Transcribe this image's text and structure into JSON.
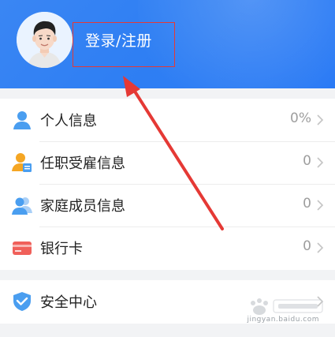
{
  "header": {
    "login_label": "登录/注册",
    "background_color": "#2f7ff3"
  },
  "menu": {
    "items": [
      {
        "label": "个人信息",
        "value": "0%",
        "icon": "person-icon"
      },
      {
        "label": "任职受雇信息",
        "value": "0",
        "icon": "employment-badge-icon"
      },
      {
        "label": "家庭成员信息",
        "value": "0",
        "icon": "family-members-icon"
      },
      {
        "label": "银行卡",
        "value": "0",
        "icon": "bank-card-icon"
      }
    ],
    "security": {
      "label": "安全中心",
      "icon": "shield-check-icon"
    }
  },
  "watermark": {
    "text": "jingyan.baidu.com"
  },
  "colors": {
    "accent_blue": "#2f7ff3",
    "icon_blue": "#4a9ef0",
    "icon_orange": "#f5a623",
    "icon_red": "#f0605a",
    "annotation_red": "#e53935"
  }
}
